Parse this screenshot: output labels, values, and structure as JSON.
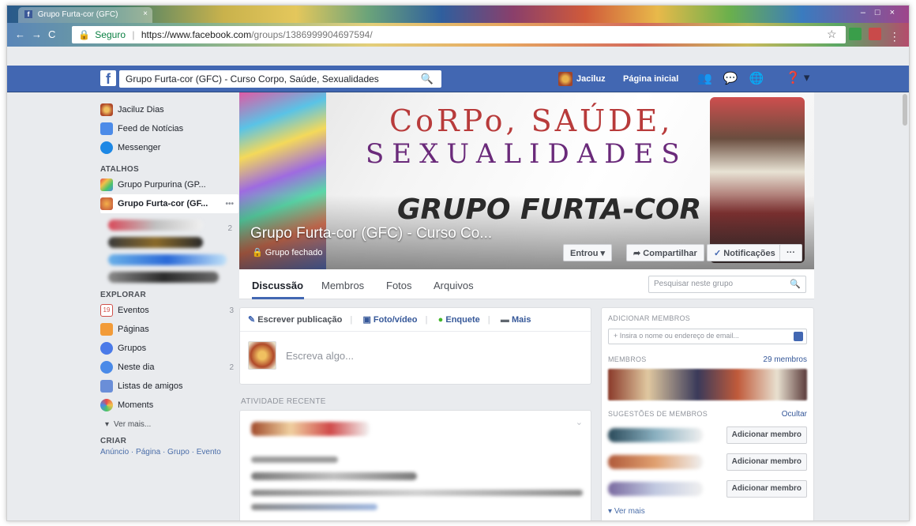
{
  "browser": {
    "tab_title": "Grupo Furta-cor (GFC)",
    "secure_label": "Seguro",
    "url_host": "https://www.facebook.com",
    "url_path": "/groups/1386999904697594/"
  },
  "fb": {
    "search_value": "Grupo Furta-cor (GFC) - Curso Corpo, Saúde, Sexualidades",
    "user_name": "Jaciluz",
    "home_label": "Página inicial"
  },
  "sidebar": {
    "profile_name": "Jaciluz Dias",
    "items": [
      {
        "label": "Feed de Notícias"
      },
      {
        "label": "Messenger"
      }
    ],
    "atalhos_heading": "ATALHOS",
    "shortcuts": [
      {
        "label": "Grupo Purpurina (GP..."
      },
      {
        "label": "Grupo Furta-cor (GF..."
      }
    ],
    "shortcut_more": "•••",
    "shortcut_count": "2",
    "explorar_heading": "EXPLORAR",
    "explore": [
      {
        "label": "Eventos",
        "count": "3"
      },
      {
        "label": "Páginas",
        "count": ""
      },
      {
        "label": "Grupos",
        "count": ""
      },
      {
        "label": "Neste dia",
        "count": "2"
      },
      {
        "label": "Listas de amigos",
        "count": ""
      },
      {
        "label": "Moments",
        "count": ""
      }
    ],
    "events_day": "19",
    "see_more": "Ver mais...",
    "criar_heading": "CRIAR",
    "criar_links": "Anúncio · Página · Grupo · Evento"
  },
  "cover": {
    "art_line1": "CoRPo, SAÚDE,",
    "art_line2": "SEXUALIDADES",
    "art_big": "GRUPO FURTA-COR",
    "group_title": "Grupo Furta-cor (GFC) - Curso Co...",
    "privacy": "Grupo fechado",
    "btn_joined": "Entrou ▾",
    "btn_share": "Compartilhar",
    "btn_notif": "Notificações",
    "btn_more": "···"
  },
  "tabs": [
    {
      "label": "Discussão"
    },
    {
      "label": "Membros"
    },
    {
      "label": "Fotos"
    },
    {
      "label": "Arquivos"
    }
  ],
  "group_search_placeholder": "Pesquisar neste grupo",
  "composer": {
    "write": "Escrever publicação",
    "photo": "Foto/vídeo",
    "poll": "Enquete",
    "more": "Mais",
    "placeholder": "Escreva algo..."
  },
  "recent_heading": "ATIVIDADE RECENTE",
  "right": {
    "add_heading": "ADICIONAR MEMBROS",
    "add_placeholder": "+ Insira o nome ou endereço de email...",
    "members_heading": "MEMBROS",
    "members_count": "29 membros",
    "suggest_heading": "SUGESTÕES DE MEMBROS",
    "hide_label": "Ocultar",
    "add_member_label": "Adicionar membro",
    "see_more": "Ver mais"
  }
}
